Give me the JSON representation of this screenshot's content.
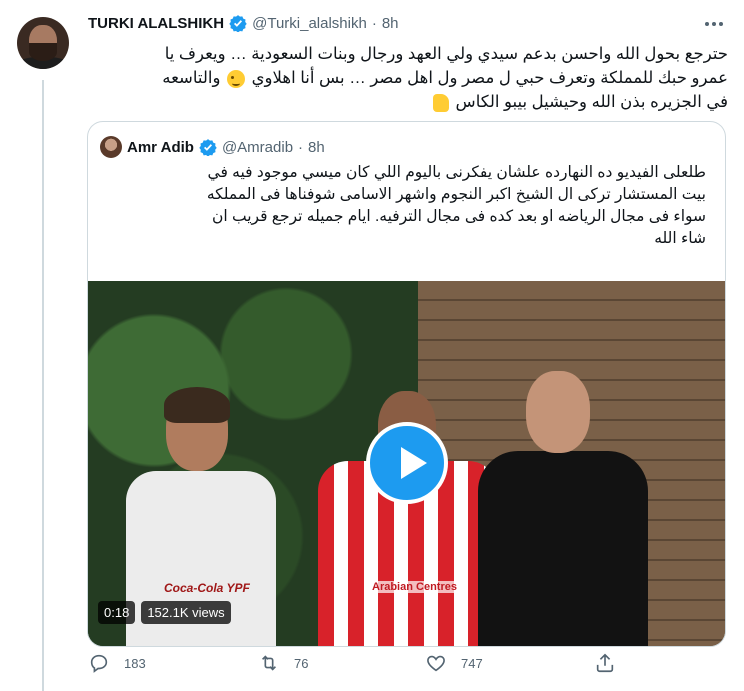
{
  "tweet": {
    "author_name": "TURKI ALALSHIKH",
    "handle": "@Turki_alalshikh",
    "separator": "·",
    "time": "8h",
    "text_line1": "حترجع بحول الله واحسن بدعم سيدي ولي العهد ورجال وبنات السعودية … ويعرف يا",
    "text_line2_a": "عمرو حبك للمملكة وتعرف حبي ل مصر ول اهل مصر … بس أنا اهلاوي",
    "text_line2_b": "والتاسعه",
    "text_line3": "في الجزيره بذن الله وحيشيل بيبو الكاس",
    "emojis": [
      "wink-emoji",
      "thumbs-up-emoji"
    ]
  },
  "quote": {
    "author_name": "Amr Adib",
    "handle": "@Amradib",
    "separator": "·",
    "time": "8h",
    "text_line1": "طلعلى الفيديو ده النهارده علشان يفكرنى باليوم اللي كان ميسي موجود فيه في",
    "text_line2": "بيت المستشار تركى ال الشيخ اكبر النجوم واشهر الاسامى شوفناها فى المملكه",
    "text_line3": "سواء فى مجال الرياضه او بعد كده فى مجال الترفيه. ايام جميله ترجع قريب ان",
    "text_line4": "شاء الله",
    "video": {
      "duration": "0:18",
      "views": "152.1K views",
      "shirt_text": "Arabian Centres",
      "jersey_text": "Coca-Cola YPF"
    }
  },
  "actions": {
    "reply_count": "183",
    "retweet_count": "76",
    "like_count": "747"
  },
  "colors": {
    "accent": "#1d9bf0",
    "muted": "#536471",
    "border": "#cfd9de"
  },
  "icons": [
    "verified-badge-icon",
    "more-options-icon",
    "play-icon",
    "reply-icon",
    "retweet-icon",
    "like-icon",
    "share-icon"
  ]
}
